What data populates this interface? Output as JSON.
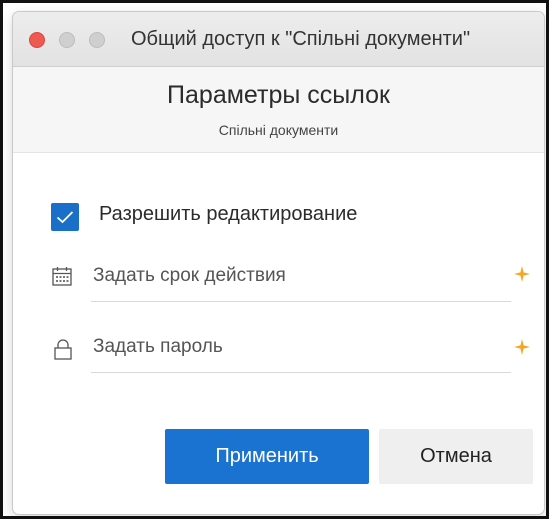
{
  "window": {
    "title": "Общий доступ к \"Спільні документи\""
  },
  "dialog": {
    "title": "Параметры ссылок",
    "subtitle": "Спільні документи"
  },
  "options": {
    "allow_edit_label": "Разрешить редактирование",
    "allow_edit_checked": true,
    "expiry_placeholder": "Задать срок действия",
    "password_placeholder": "Задать пароль"
  },
  "icons": {
    "calendar": "calendar-icon",
    "lock": "lock-icon",
    "premium": "premium-star-icon"
  },
  "buttons": {
    "apply": "Применить",
    "cancel": "Отмена"
  },
  "colors": {
    "accent": "#1a73d1",
    "premium_star": "#f3a724",
    "close_button": "#ee5a52"
  }
}
